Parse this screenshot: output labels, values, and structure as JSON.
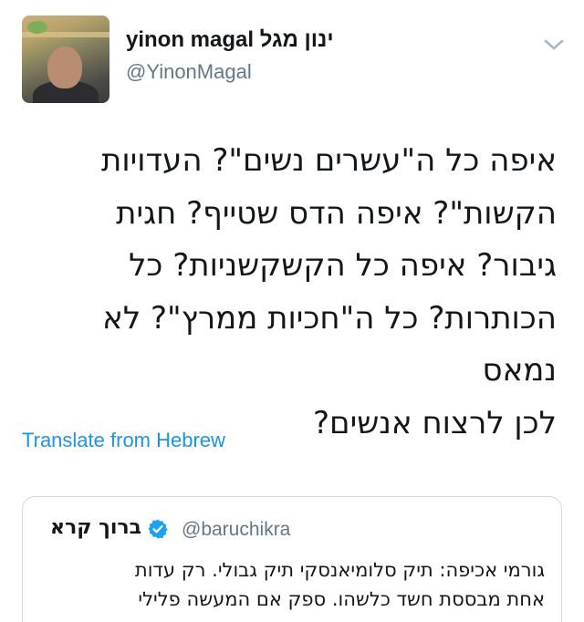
{
  "author": {
    "display_name": "yinon magal ינון מגל",
    "handle": "@YinonMagal",
    "avatar_icon": "profile-photo"
  },
  "menu_icon": "chevron-down-icon",
  "tweet": {
    "lines": [
      "איפה כל ה\"עשרים נשים\"? העדויות",
      "הקשות\"? איפה הדס שטייף? חגית",
      "גיבור? איפה כל הקשקשניות? כל",
      "הכותרות? כל ה\"חכיות ממרץ\"? לא נמאס",
      "לכן לרצוח אנשים?"
    ]
  },
  "translate_link": "Translate from Hebrew",
  "quoted_tweet": {
    "name": "ברוך קרא",
    "verified_icon": "verified-badge-icon",
    "handle": "@baruchikra",
    "lines": [
      "גורמי אכיפה: תיק סלומיאנסקי תיק גבולי. רק עדות",
      "אחת מבססת חשד כלשהו. ספק אם המעשה פלילי"
    ]
  },
  "colors": {
    "link": "#1b95e0",
    "secondary_text": "#657786",
    "verified": "#1da1f2",
    "border": "#cfd9de"
  }
}
